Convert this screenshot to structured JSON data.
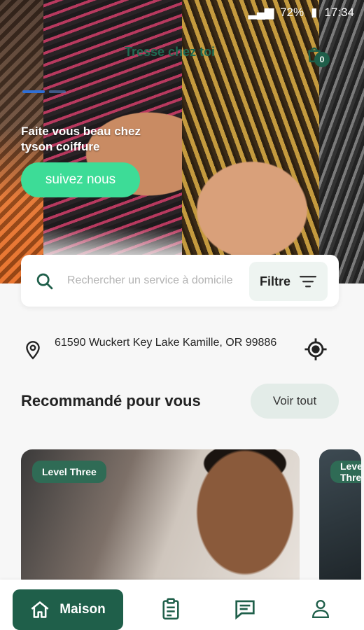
{
  "status_bar": {
    "battery": "72%",
    "time": "17:34"
  },
  "header": {
    "app_name": "Tresse chez toi",
    "cart_count": "0"
  },
  "hero": {
    "slides_total": 2,
    "active_slide": 1,
    "headline": "Faite vous beau chez tyson coiffure",
    "follow_label": "suivez nous"
  },
  "search": {
    "placeholder": "Rechercher un service à domicile",
    "filter_label": "Filtre"
  },
  "location": {
    "address": "61590 Wuckert Key Lake Kamille, OR 99886"
  },
  "recommended": {
    "title": "Recommandé pour vous",
    "see_all_label": "Voir tout",
    "cards": [
      {
        "badge": "Level Three"
      },
      {
        "badge": "Level Three"
      }
    ]
  },
  "bottom_nav": {
    "items": [
      {
        "label": "Maison",
        "icon": "home-icon",
        "active": true
      },
      {
        "label": "",
        "icon": "clipboard-icon",
        "active": false
      },
      {
        "label": "",
        "icon": "message-icon",
        "active": false
      },
      {
        "label": "",
        "icon": "user-icon",
        "active": false
      }
    ]
  },
  "colors": {
    "brand_dark": "#1f5f4a",
    "accent_green": "#3ddc97",
    "badge_green": "#2f6b55"
  }
}
